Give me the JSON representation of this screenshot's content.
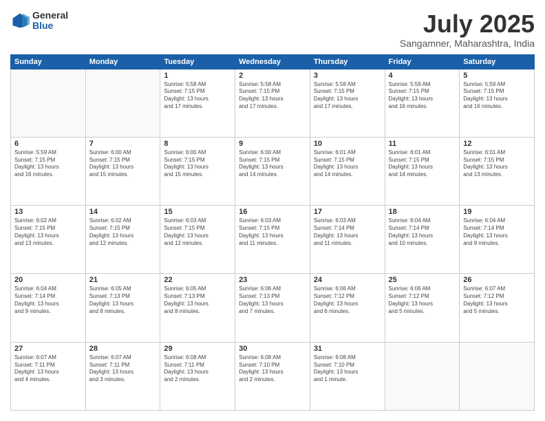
{
  "logo": {
    "general": "General",
    "blue": "Blue"
  },
  "header": {
    "month": "July 2025",
    "location": "Sangamner, Maharashtra, India"
  },
  "weekdays": [
    "Sunday",
    "Monday",
    "Tuesday",
    "Wednesday",
    "Thursday",
    "Friday",
    "Saturday"
  ],
  "weeks": [
    [
      {
        "day": "",
        "info": ""
      },
      {
        "day": "",
        "info": ""
      },
      {
        "day": "1",
        "info": "Sunrise: 5:58 AM\nSunset: 7:15 PM\nDaylight: 13 hours\nand 17 minutes."
      },
      {
        "day": "2",
        "info": "Sunrise: 5:58 AM\nSunset: 7:15 PM\nDaylight: 13 hours\nand 17 minutes."
      },
      {
        "day": "3",
        "info": "Sunrise: 5:58 AM\nSunset: 7:15 PM\nDaylight: 13 hours\nand 17 minutes."
      },
      {
        "day": "4",
        "info": "Sunrise: 5:59 AM\nSunset: 7:15 PM\nDaylight: 13 hours\nand 16 minutes."
      },
      {
        "day": "5",
        "info": "Sunrise: 5:59 AM\nSunset: 7:15 PM\nDaylight: 13 hours\nand 16 minutes."
      }
    ],
    [
      {
        "day": "6",
        "info": "Sunrise: 5:59 AM\nSunset: 7:15 PM\nDaylight: 13 hours\nand 16 minutes."
      },
      {
        "day": "7",
        "info": "Sunrise: 6:00 AM\nSunset: 7:15 PM\nDaylight: 13 hours\nand 15 minutes."
      },
      {
        "day": "8",
        "info": "Sunrise: 6:00 AM\nSunset: 7:15 PM\nDaylight: 13 hours\nand 15 minutes."
      },
      {
        "day": "9",
        "info": "Sunrise: 6:00 AM\nSunset: 7:15 PM\nDaylight: 13 hours\nand 14 minutes."
      },
      {
        "day": "10",
        "info": "Sunrise: 6:01 AM\nSunset: 7:15 PM\nDaylight: 13 hours\nand 14 minutes."
      },
      {
        "day": "11",
        "info": "Sunrise: 6:01 AM\nSunset: 7:15 PM\nDaylight: 13 hours\nand 14 minutes."
      },
      {
        "day": "12",
        "info": "Sunrise: 6:01 AM\nSunset: 7:15 PM\nDaylight: 13 hours\nand 13 minutes."
      }
    ],
    [
      {
        "day": "13",
        "info": "Sunrise: 6:02 AM\nSunset: 7:15 PM\nDaylight: 13 hours\nand 13 minutes."
      },
      {
        "day": "14",
        "info": "Sunrise: 6:02 AM\nSunset: 7:15 PM\nDaylight: 13 hours\nand 12 minutes."
      },
      {
        "day": "15",
        "info": "Sunrise: 6:03 AM\nSunset: 7:15 PM\nDaylight: 13 hours\nand 12 minutes."
      },
      {
        "day": "16",
        "info": "Sunrise: 6:03 AM\nSunset: 7:15 PM\nDaylight: 13 hours\nand 11 minutes."
      },
      {
        "day": "17",
        "info": "Sunrise: 6:03 AM\nSunset: 7:14 PM\nDaylight: 13 hours\nand 11 minutes."
      },
      {
        "day": "18",
        "info": "Sunrise: 6:04 AM\nSunset: 7:14 PM\nDaylight: 13 hours\nand 10 minutes."
      },
      {
        "day": "19",
        "info": "Sunrise: 6:04 AM\nSunset: 7:14 PM\nDaylight: 13 hours\nand 9 minutes."
      }
    ],
    [
      {
        "day": "20",
        "info": "Sunrise: 6:04 AM\nSunset: 7:14 PM\nDaylight: 13 hours\nand 9 minutes."
      },
      {
        "day": "21",
        "info": "Sunrise: 6:05 AM\nSunset: 7:13 PM\nDaylight: 13 hours\nand 8 minutes."
      },
      {
        "day": "22",
        "info": "Sunrise: 6:05 AM\nSunset: 7:13 PM\nDaylight: 13 hours\nand 8 minutes."
      },
      {
        "day": "23",
        "info": "Sunrise: 6:06 AM\nSunset: 7:13 PM\nDaylight: 13 hours\nand 7 minutes."
      },
      {
        "day": "24",
        "info": "Sunrise: 6:06 AM\nSunset: 7:12 PM\nDaylight: 13 hours\nand 6 minutes."
      },
      {
        "day": "25",
        "info": "Sunrise: 6:06 AM\nSunset: 7:12 PM\nDaylight: 13 hours\nand 5 minutes."
      },
      {
        "day": "26",
        "info": "Sunrise: 6:07 AM\nSunset: 7:12 PM\nDaylight: 13 hours\nand 5 minutes."
      }
    ],
    [
      {
        "day": "27",
        "info": "Sunrise: 6:07 AM\nSunset: 7:11 PM\nDaylight: 13 hours\nand 4 minutes."
      },
      {
        "day": "28",
        "info": "Sunrise: 6:07 AM\nSunset: 7:11 PM\nDaylight: 13 hours\nand 3 minutes."
      },
      {
        "day": "29",
        "info": "Sunrise: 6:08 AM\nSunset: 7:11 PM\nDaylight: 13 hours\nand 2 minutes."
      },
      {
        "day": "30",
        "info": "Sunrise: 6:08 AM\nSunset: 7:10 PM\nDaylight: 13 hours\nand 2 minutes."
      },
      {
        "day": "31",
        "info": "Sunrise: 6:08 AM\nSunset: 7:10 PM\nDaylight: 13 hours\nand 1 minute."
      },
      {
        "day": "",
        "info": ""
      },
      {
        "day": "",
        "info": ""
      }
    ]
  ]
}
